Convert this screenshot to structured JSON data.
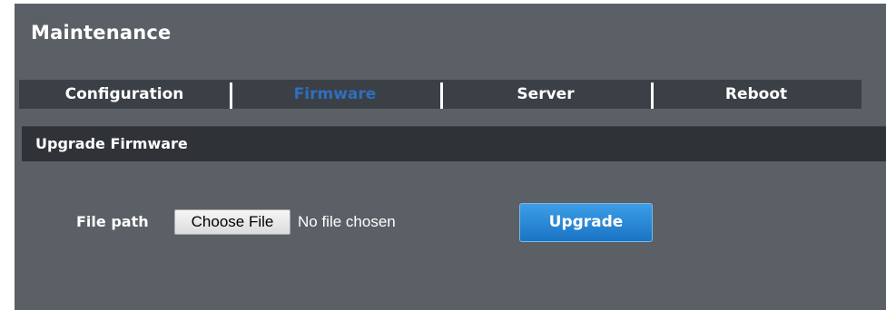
{
  "page": {
    "title": "Maintenance"
  },
  "tabs": [
    {
      "label": "Configuration",
      "active": false
    },
    {
      "label": "Firmware",
      "active": true
    },
    {
      "label": "Server",
      "active": false
    },
    {
      "label": "Reboot",
      "active": false
    }
  ],
  "section": {
    "title": "Upgrade Firmware"
  },
  "form": {
    "file_path_label": "File path",
    "choose_file_label": "Choose File",
    "file_status": "No file chosen",
    "upgrade_label": "Upgrade"
  },
  "colors": {
    "panel_background": "#5a6066",
    "tab_bar_background": "#3b4046",
    "active_tab_text": "#2f6ec0",
    "section_bar_background": "#2f3338",
    "upgrade_button": "#1f80d0"
  }
}
